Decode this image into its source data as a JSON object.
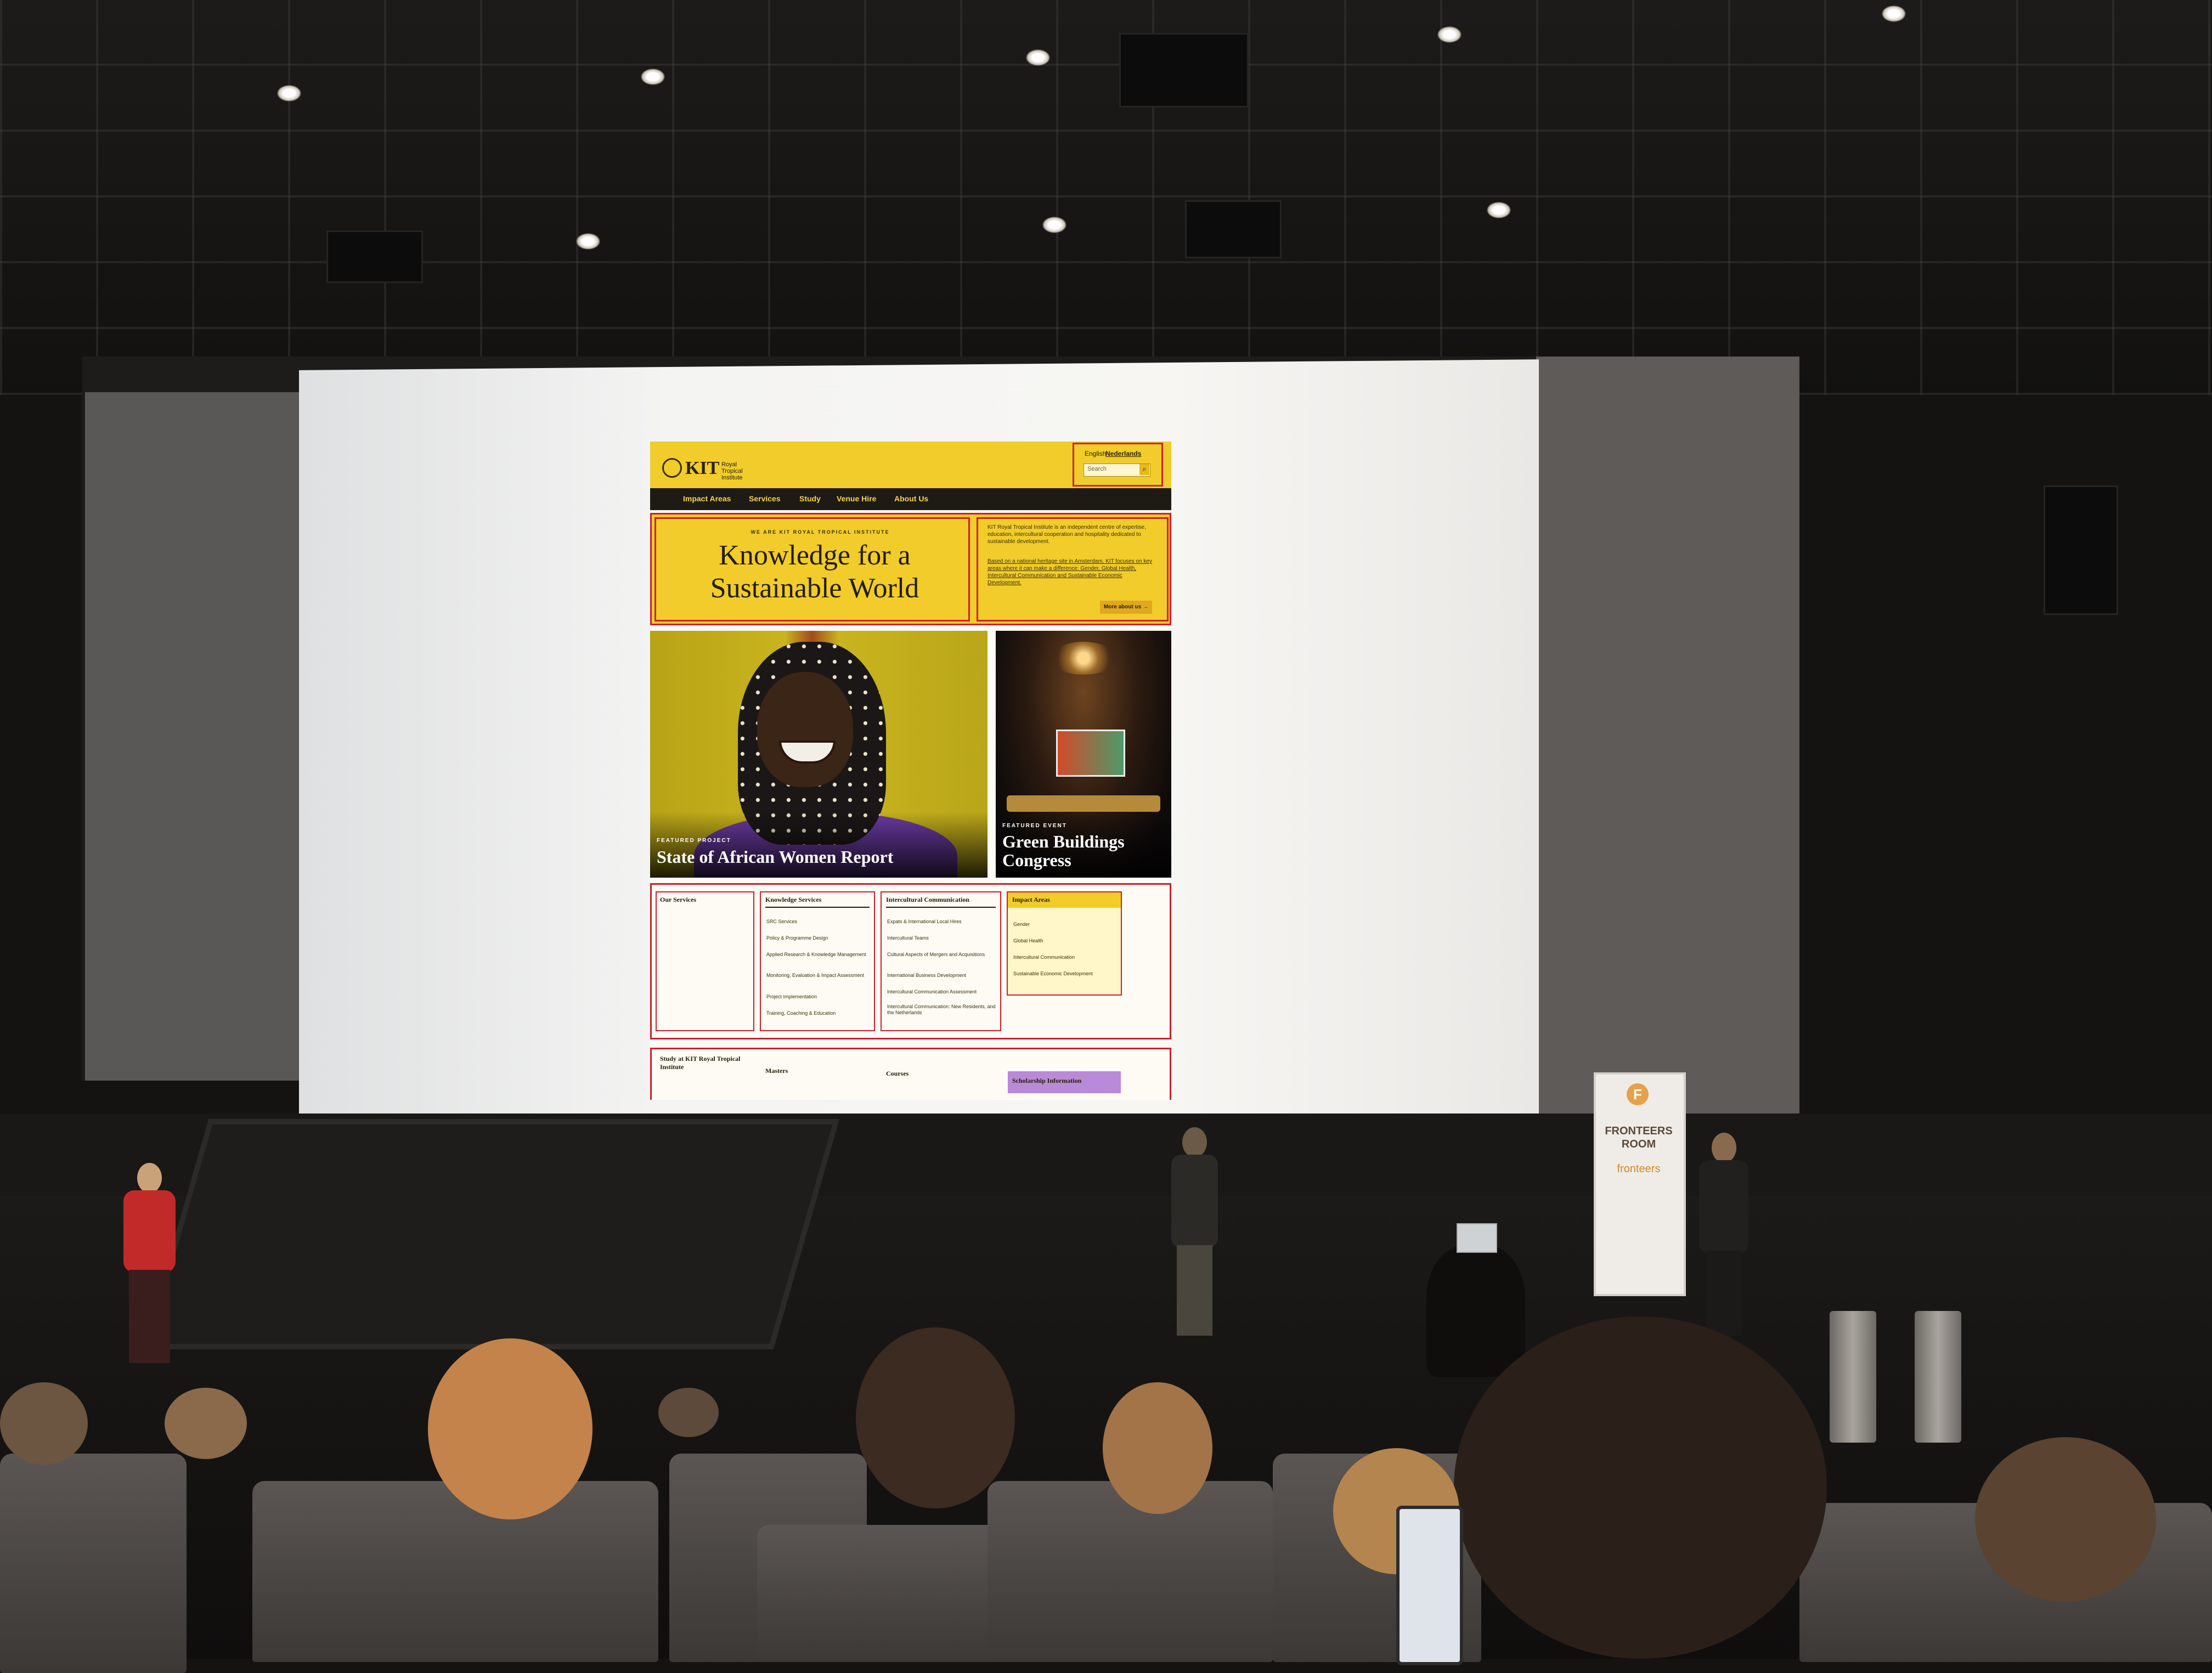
{
  "website": {
    "logo": {
      "name": "KIT",
      "subtitle": "Royal Tropical Institute"
    },
    "languages": {
      "english": "English",
      "nederlands": "Nederlands"
    },
    "search_placeholder": "Search",
    "nav": [
      "Impact Areas",
      "Services",
      "Study",
      "Venue Hire",
      "About Us"
    ],
    "hero": {
      "eyebrow": "WE ARE KIT ROYAL TROPICAL INSTITUTE",
      "title": "Knowledge for a Sustainable World",
      "intro_1": "KIT Royal Tropical Institute is an independent centre of expertise, education, intercultural cooperation and hospitality dedicated to sustainable development.",
      "intro_2": "Based on a national heritage site in Amsterdam, KIT focuses on key areas where it can make a difference: Gender, Global Health, Intercultural Communication and Sustainable Economic Development.",
      "more_button": "More about us →"
    },
    "featured": [
      {
        "label": "FEATURED PROJECT",
        "title": "State of African Women Report"
      },
      {
        "label": "FEATURED EVENT",
        "title": "Green Buildings Congress"
      }
    ],
    "services": {
      "heading": "Our Services",
      "columns": [
        {
          "title": "Knowledge Services",
          "items": [
            "SRC Services",
            "Policy & Programme Design",
            "Applied Research & Knowledge Management",
            "Monitoring, Evaluation & Impact Assessment",
            "Project Implementation",
            "Training, Coaching & Education"
          ]
        },
        {
          "title": "Intercultural Communication",
          "items": [
            "Expats & International Local Hires",
            "Intercultural Teams",
            "Cultural Aspects of Mergers and Acquisitions",
            "International Business Development",
            "Intercultural Communication Assessment",
            "Intercultural Communication: New Residents, and the Netherlands"
          ]
        },
        {
          "title": "Impact Areas",
          "items": [
            "Gender",
            "Global Health",
            "Intercultural Communication",
            "Sustainable Economic Development"
          ]
        }
      ]
    },
    "study": {
      "heading": "Study at KIT Royal Tropical Institute",
      "columns": [
        "Masters",
        "Courses",
        "Scholarship Information"
      ]
    }
  },
  "banner": {
    "logo": "F",
    "title": "FRONTEERS ROOM",
    "brand": "fronteers"
  },
  "colors": {
    "kit_yellow": "#f1cc2a",
    "outline_red": "#c8222c",
    "nav_dark": "#1e1a14"
  }
}
